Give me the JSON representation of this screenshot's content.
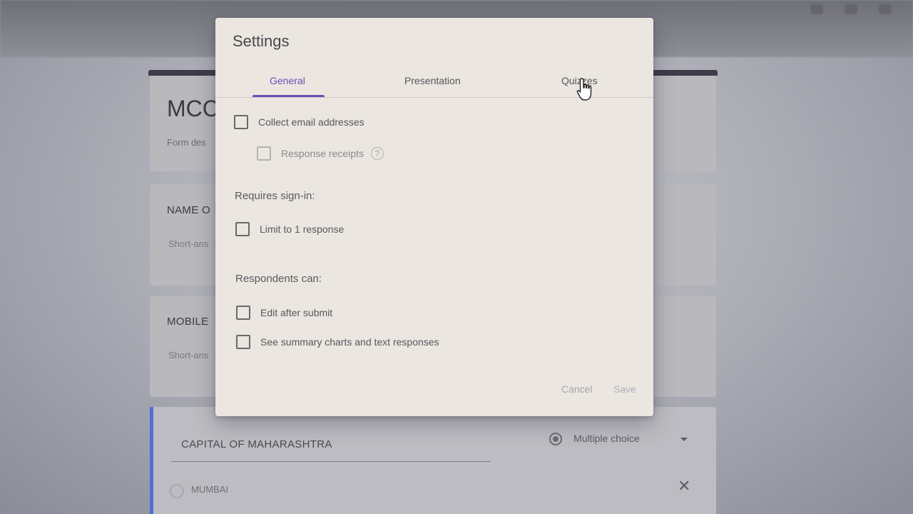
{
  "background": {
    "form_title": "MCC",
    "form_description": "Form des",
    "question_1": {
      "title": "NAME O",
      "answer_hint": "Short-ans"
    },
    "question_2": {
      "title": "MOBILE",
      "answer_hint": "Short-ans"
    },
    "question_3": {
      "title": "CAPITAL OF MAHARASHTRA",
      "type": "Multiple choice",
      "option": "MUMBAI"
    },
    "accent_color": "#4f6fd8"
  },
  "dialog": {
    "title": "Settings",
    "tabs": [
      {
        "label": "General",
        "active": true
      },
      {
        "label": "Presentation",
        "active": false
      },
      {
        "label": "Quizzes",
        "active": false
      }
    ],
    "collect_email": {
      "label": "Collect email addresses",
      "checked": false
    },
    "response_receipts": {
      "label": "Response receipts",
      "checked": false,
      "help": "?"
    },
    "requires_signin": {
      "header": "Requires sign-in:",
      "limit_one": {
        "label": "Limit to 1 response",
        "checked": false
      }
    },
    "respondents_can": {
      "header": "Respondents can:",
      "edit_after_submit": {
        "label": "Edit after submit",
        "checked": false
      },
      "see_summary": {
        "label": "See summary charts and text responses",
        "checked": false
      }
    },
    "buttons": {
      "cancel": "Cancel",
      "save": "Save"
    },
    "accent_color": "#6c4fb8"
  }
}
